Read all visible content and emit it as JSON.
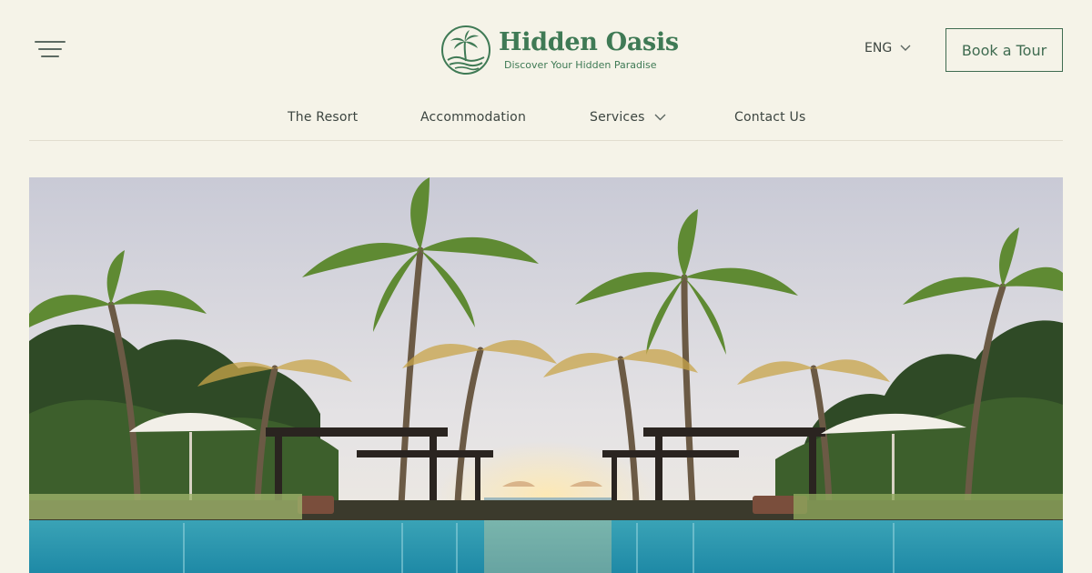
{
  "header": {
    "menu_icon": "hamburger-menu-icon",
    "brand_name": "Hidden Oasis",
    "brand_tagline": "Discover Your Hidden Paradise",
    "brand_logo_icon": "palm-island-logo-icon",
    "language": "ENG",
    "language_icon": "chevron-down-icon",
    "cta_label": "Book a Tour"
  },
  "nav": {
    "items": [
      {
        "label": "The Resort"
      },
      {
        "label": "Accommodation"
      },
      {
        "label": "Services",
        "icon": "chevron-down-icon"
      },
      {
        "label": "Contact Us"
      }
    ]
  },
  "hero": {
    "image": "tropical-resort-pool-with-palm-trees-and-umbrellas"
  },
  "colors": {
    "background": "#f5f3e8",
    "brand_green": "#3f7a55",
    "text": "#3c4540",
    "divider": "#e1ddcf"
  }
}
